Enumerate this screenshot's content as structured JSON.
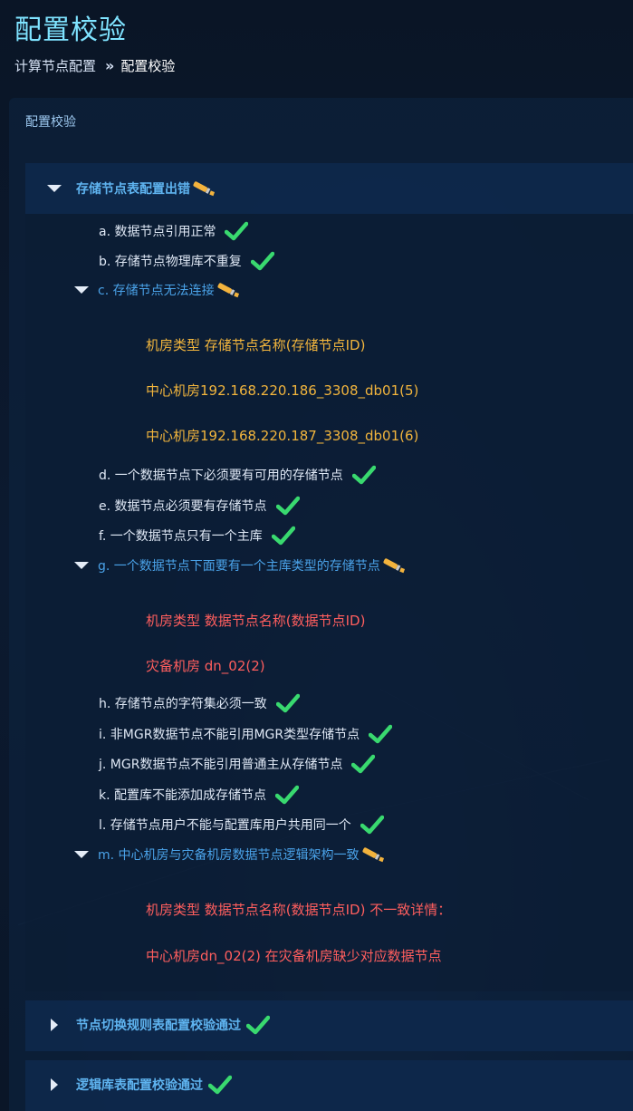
{
  "page": {
    "title": "配置校验",
    "breadcrumb": {
      "parent": "计算节点配置",
      "separator": "»",
      "current": "配置校验"
    }
  },
  "panel": {
    "title": "配置校验"
  },
  "colors": {
    "ok_check": "#39d96f",
    "warn_icon": "#f3b33d",
    "error_text": "#ff5e5e",
    "detail_text": "#f2b53d",
    "link_blue": "#4aa2e8"
  },
  "sections": [
    {
      "label": "存储节点表配置出错",
      "status": "warning",
      "expanded": true,
      "items": [
        {
          "label": "a. 数据节点引用正常",
          "status": "ok"
        },
        {
          "label": "b. 存储节点物理库不重复",
          "status": "ok"
        },
        {
          "label": "c. 存储节点无法连接",
          "status": "warning",
          "expanded": true,
          "details": [
            "机房类型 存储节点名称(存储节点ID)",
            "中心机房192.168.220.186_3308_db01(5)",
            "中心机房192.168.220.187_3308_db01(6)"
          ]
        },
        {
          "label": "d. 一个数据节点下必须要有可用的存储节点",
          "status": "ok"
        },
        {
          "label": "e. 数据节点必须要有存储节点",
          "status": "ok"
        },
        {
          "label": "f. 一个数据节点只有一个主库",
          "status": "ok"
        },
        {
          "label": "g. 一个数据节点下面要有一个主库类型的存储节点",
          "status": "warning",
          "expanded": true,
          "details": [
            "机房类型 数据节点名称(数据节点ID)",
            "灾备机房 dn_02(2)"
          ]
        },
        {
          "label": "h. 存储节点的字符集必须一致",
          "status": "ok"
        },
        {
          "label": "i. 非MGR数据节点不能引用MGR类型存储节点",
          "status": "ok"
        },
        {
          "label": "j. MGR数据节点不能引用普通主从存储节点",
          "status": "ok"
        },
        {
          "label": "k. 配置库不能添加成存储节点",
          "status": "ok"
        },
        {
          "label": "l. 存储节点用户不能与配置库用户共用同一个",
          "status": "ok"
        },
        {
          "label": "m. 中心机房与灾备机房数据节点逻辑架构一致",
          "status": "warning",
          "expanded": true,
          "details": [
            "机房类型 数据节点名称(数据节点ID) 不一致详情：",
            "中心机房dn_02(2) 在灾备机房缺少对应数据节点"
          ]
        }
      ]
    },
    {
      "label": "节点切换规则表配置校验通过",
      "status": "ok",
      "expanded": false
    },
    {
      "label": "逻辑库表配置校验通过",
      "status": "ok",
      "expanded": false
    }
  ]
}
